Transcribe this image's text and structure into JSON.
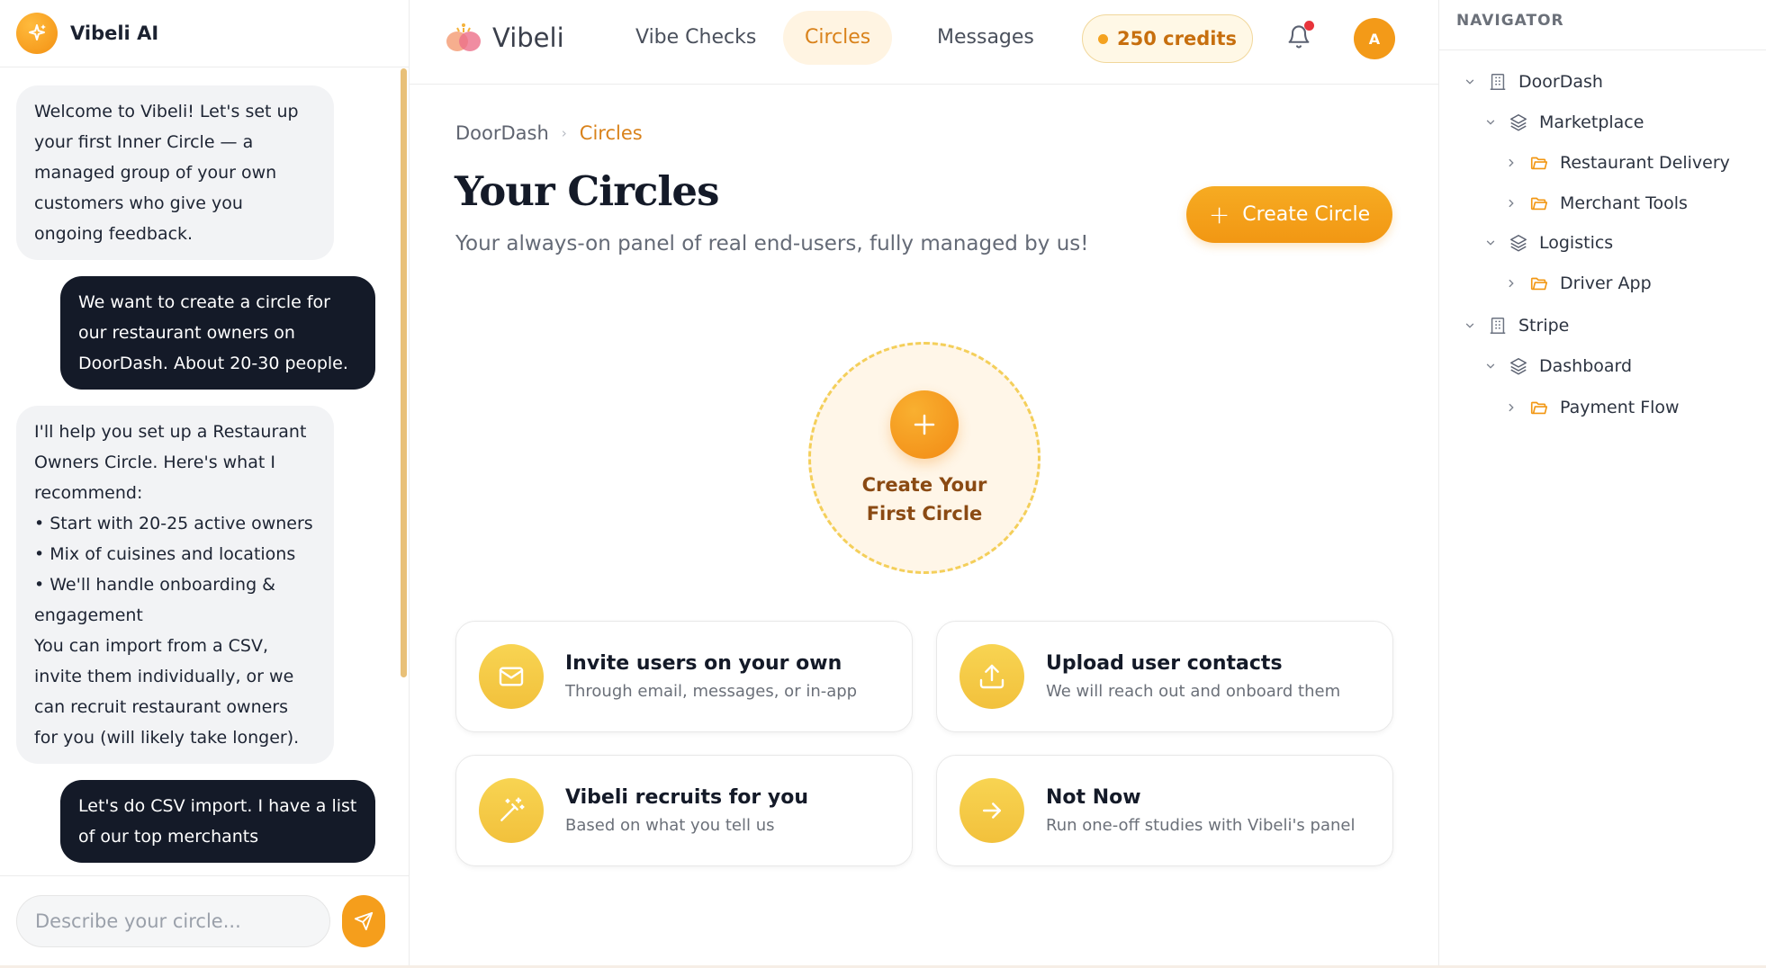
{
  "chat": {
    "title": "Vibeli AI",
    "messages": [
      {
        "role": "ai",
        "text": "Welcome to Vibeli! Let's set up your first Inner Circle — a managed group of your own customers who give you ongoing feedback."
      },
      {
        "role": "user",
        "text": "We want to create a circle for our restaurant owners on DoorDash. About 20-30 people."
      },
      {
        "role": "ai",
        "text": "I'll help you set up a Restaurant Owners Circle. Here's what I recommend:\n• Start with 20-25 active owners\n• Mix of cuisines and locations\n• We'll handle onboarding & engagement\nYou can import from a CSV, invite them individually, or we can recruit restaurant owners for you (will likely take longer)."
      },
      {
        "role": "user",
        "text": "Let's do CSV import. I have a list of our top merchants"
      }
    ],
    "input_placeholder": "Describe your circle..."
  },
  "topbar": {
    "brand": "Vibeli",
    "nav": [
      "Vibe Checks",
      "Circles",
      "Messages"
    ],
    "active_nav": "Circles",
    "credits": "250 credits",
    "avatar_initial": "A"
  },
  "main": {
    "breadcrumb": [
      "DoorDash",
      "Circles"
    ],
    "title": "Your Circles",
    "subtitle": "Your always-on panel of real end-users, fully managed by us!",
    "create_button": "Create Circle",
    "first_circle_label": "Create Your\nFirst Circle",
    "options": [
      {
        "title": "Invite users on your own",
        "subtitle": "Through email, messages, or in-app",
        "icon": "mail-icon"
      },
      {
        "title": "Upload user contacts",
        "subtitle": "We will reach out and onboard them",
        "icon": "upload-icon"
      },
      {
        "title": "Vibeli recruits for you",
        "subtitle": "Based on what you tell us",
        "icon": "magic-wand-icon"
      },
      {
        "title": "Not Now",
        "subtitle": "Run one-off studies with Vibeli's panel",
        "icon": "arrow-right-icon"
      }
    ]
  },
  "navigator": {
    "header": "NAVIGATOR",
    "tree": [
      {
        "label": "DoorDash",
        "type": "company",
        "expanded": true
      },
      {
        "label": "Marketplace",
        "type": "layer",
        "expanded": true
      },
      {
        "label": "Restaurant Delivery",
        "type": "folder",
        "expanded": false
      },
      {
        "label": "Merchant Tools",
        "type": "folder",
        "expanded": false
      },
      {
        "label": "Logistics",
        "type": "layer",
        "expanded": true
      },
      {
        "label": "Driver App",
        "type": "folder",
        "expanded": false
      },
      {
        "label": "Stripe",
        "type": "company",
        "expanded": true
      },
      {
        "label": "Dashboard",
        "type": "layer",
        "expanded": true
      },
      {
        "label": "Payment Flow",
        "type": "folder",
        "expanded": false
      }
    ]
  },
  "colors": {
    "accent": "#f29713",
    "accent_text": "#d9821b",
    "dark_bubble": "#141a28",
    "notification": "#e8343b"
  }
}
